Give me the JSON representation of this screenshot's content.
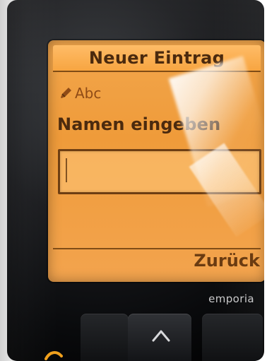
{
  "device": {
    "brand": "emporia"
  },
  "screen": {
    "title": "Neuer Eintrag",
    "input_mode": "Abc",
    "prompt": "Namen eingeben",
    "input_value": "",
    "right_softkey": "Zurück"
  },
  "icons": {
    "mode_icon": "pencil-icon",
    "nav_up_icon": "chevron-up-icon"
  },
  "colors": {
    "screen_orange": "#ef9b3a",
    "screen_text_dark": "#4b2a0e",
    "screen_text_accent": "#8f4b16",
    "phone_black": "#0b0b0d"
  }
}
